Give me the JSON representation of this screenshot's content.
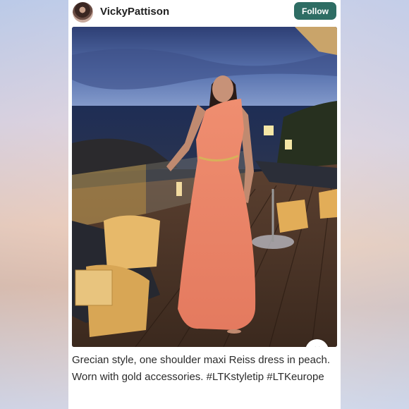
{
  "post": {
    "username": "VickyPattison",
    "follow_label": "Follow",
    "caption": "Grecian style, one shoulder maxi Reiss dress in peach. Worn with gold accessories. #LTKstyletip #LTKeurope"
  },
  "icons": {
    "avatar": "profile-photo",
    "like": "heart-outline-icon"
  },
  "colors": {
    "follow_button": "#2e6d64",
    "dress": "#e98366"
  }
}
